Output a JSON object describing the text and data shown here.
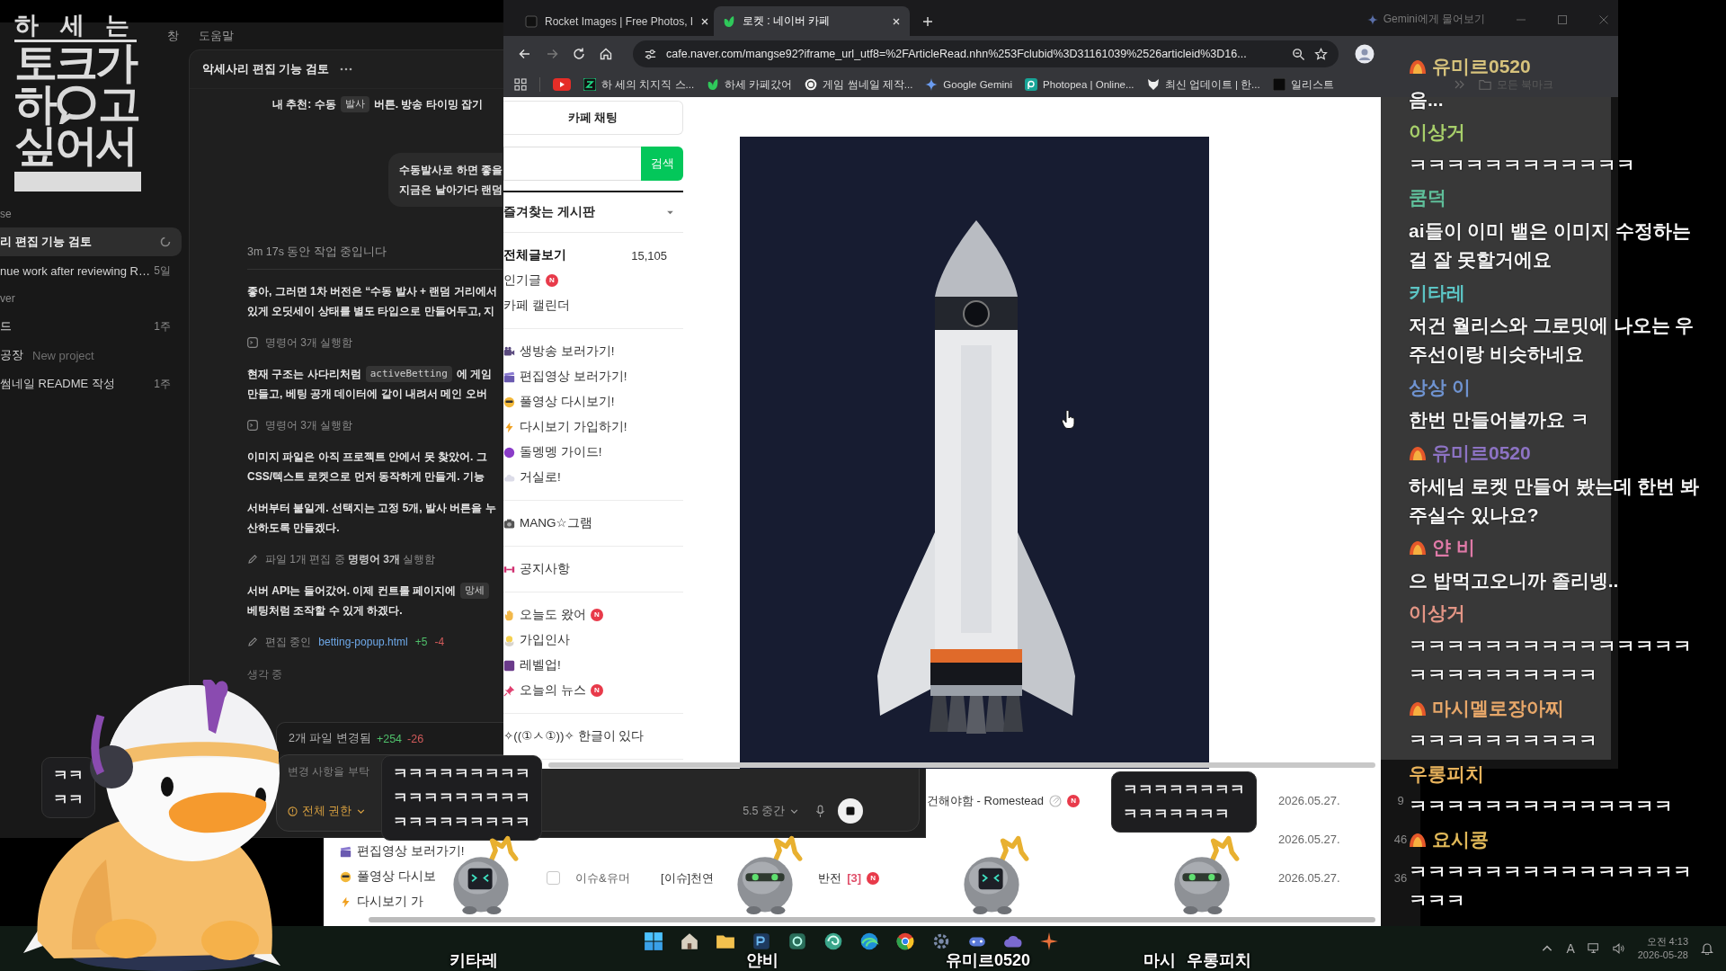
{
  "stream_logo": {
    "caption": "하 세 는",
    "line_1": "토크가",
    "line_2_start": "하",
    "line_2_end": "고",
    "line_3": "싶어서"
  },
  "code_app": {
    "menu": [
      "창",
      "도움말"
    ],
    "sidebar": [
      {
        "kind": "section",
        "label": "se"
      },
      {
        "kind": "thread",
        "label": "리 편집 기능 검토",
        "selected": true,
        "running": true
      },
      {
        "kind": "thread",
        "label": "nue work after reviewing R…",
        "selected": false,
        "running": false,
        "age": "5일"
      },
      {
        "kind": "section",
        "label": "ver"
      },
      {
        "kind": "thread",
        "label": "드",
        "selected": false,
        "running": false,
        "age": "1주"
      },
      {
        "kind": "thread",
        "label": "공장",
        "selected": false,
        "running": false,
        "tag": "New project"
      },
      {
        "kind": "thread",
        "label": "썸네일 README 작성",
        "selected": false,
        "running": false,
        "age": "1주"
      }
    ],
    "thread_title": "악세사리 편집 기능 검토",
    "messages": [
      {
        "kind": "list_item",
        "lines": [
          [
            {
              "text": "내 추천: 수동"
            },
            {
              "code": "발사"
            },
            {
              "text": "버튼. 방송 타이밍 잡기"
            }
          ]
        ]
      },
      {
        "kind": "user",
        "lines": [
          "수동발사로 하면 좋을",
          "지금은 날아가다 랜덤"
        ]
      },
      {
        "kind": "status",
        "text": "3m 17s 동안 작업 중입니다"
      },
      {
        "kind": "text",
        "lines": [
          "좋아, 그러면 1차 버전은 “수동 발사 + 랜덤 거리에서",
          "있게 오딧세이 상태를 별도 타입으로 만들어두고, 지"
        ]
      },
      {
        "kind": "tool",
        "text": "명령어 3개 실행함"
      },
      {
        "kind": "text",
        "lines": [
          [
            {
              "text": "현재 구조는 사다리처럼"
            },
            {
              "code": "activeBetting"
            },
            {
              "text": "에 게임"
            }
          ],
          "만들고, 베팅 공개 데이터에 같이 내려서 메인 오버"
        ]
      },
      {
        "kind": "tool",
        "text": "명령어 3개 실행함"
      },
      {
        "kind": "text",
        "lines": [
          "이미지 파일은 아직 프로젝트 안에서 못 찾았어. 그",
          "CSS/텍스트 로켓으로 먼저 동작하게 만들게. 기능"
        ]
      },
      {
        "kind": "text",
        "lines": [
          "서버부터 붙일게. 선택지는 고정 5개, 발사 버튼을 누",
          "산하도록 만들겠다."
        ]
      },
      {
        "kind": "edit",
        "text": "파일 1개 편집 중 **명령어 3개** 실행함"
      },
      {
        "kind": "text",
        "lines": [
          [
            {
              "text": "서버 API는 들어갔어. 이제 컨트롤 페이지에"
            },
            {
              "code": "망세"
            }
          ],
          "베팅처럼 조작할 수 있게 하겠다."
        ]
      },
      {
        "kind": "file_edit",
        "label": "편집 중인",
        "file": "betting-popup.html",
        "added": "+5",
        "removed": "-4"
      },
      {
        "kind": "thinking",
        "text": "생각 중"
      }
    ],
    "changes": {
      "label": "2개 파일 변경됨",
      "added": "+254",
      "removed": "-26"
    },
    "composer": {
      "placeholder": "변경 사항을 부탁",
      "permission": "전체 권한",
      "model": "5.5 중간"
    }
  },
  "browser": {
    "tabs": [
      {
        "title": "Rocket Images | Free Photos, I",
        "selected": false
      },
      {
        "title": "로켓 : 네이버 카페",
        "selected": true
      }
    ],
    "gemini": "Gemini에게 물어보기",
    "url": "cafe.naver.com/mangse92?iframe_url_utf8=%2FArticleRead.nhn%253Fclubid%3D31161039%2526articleid%3D16...",
    "bookmarks": [
      "하 세의 치지직 스...",
      "하세 카페갔어",
      "게임 썸네일 제작...",
      "Google Gemini",
      "Photopea | Online...",
      "최신 업데이트 | 한...",
      "일리스트"
    ],
    "all_bookmarks": "모든 북마크",
    "cafe": {
      "chat_button": "카페 채팅",
      "search_button": "검색",
      "favorites": "즐겨찾는 게시판",
      "groups": [
        [
          {
            "kind": "total",
            "label": "전체글보기",
            "count": "15,105"
          },
          {
            "kind": "board",
            "label": "인기글",
            "badge": "N"
          },
          {
            "kind": "board",
            "label": "카페 캘린더"
          }
        ],
        [
          {
            "kind": "emoji_board",
            "label": "생방송 보러가기!"
          },
          {
            "kind": "emoji_board",
            "label": "편집영상 보러가기!"
          },
          {
            "kind": "emoji_board",
            "label": "풀영상 다시보기!"
          },
          {
            "kind": "emoji_board",
            "label": "다시보기 가입하기!"
          },
          {
            "kind": "emoji_board",
            "label": "돌멩멩 가이드!"
          },
          {
            "kind": "emoji_board",
            "label": "거실로!"
          }
        ],
        [
          {
            "kind": "emoji_board",
            "label": "MANG☆그램"
          }
        ],
        [
          {
            "kind": "emoji_board",
            "label": "공지사항"
          }
        ],
        [
          {
            "kind": "emoji_board",
            "label": "오늘도 왔어",
            "badge": "N"
          },
          {
            "kind": "emoji_board",
            "label": "가입인사"
          },
          {
            "kind": "emoji_board",
            "label": "레벨업!"
          },
          {
            "kind": "emoji_board",
            "label": "오늘의 뉴스",
            "badge": "N"
          }
        ],
        [
          {
            "kind": "board",
            "label": "✧((①ㅅ①))✧ 한글이 있다"
          }
        ]
      ]
    }
  },
  "chat": [
    {
      "user": "유미르0520",
      "color": "#d6c27c",
      "badge": true,
      "text": "음..."
    },
    {
      "user": "이상거",
      "color": "#a7cf6a",
      "badge": false,
      "text": "ㅋㅋㅋㅋㅋㅋㅋㅋㅋㅋㅋㅋ"
    },
    {
      "user": "쿰덕",
      "color": "#5fbf9a",
      "badge": false,
      "text": "ai들이 이미 뱉은 이미지 수정하는 걸 잘 못할거에요"
    },
    {
      "user": "키타레",
      "color": "#5cc4c4",
      "badge": false,
      "text": "저건 월리스와 그로밋에 나오는 우주선이랑 비슷하네요"
    },
    {
      "user": "상상 이",
      "color": "#6f93d0",
      "badge": false,
      "text": "한번 만들어볼까요 ㅋ"
    },
    {
      "user": "유미르0520",
      "color": "#8d73c4",
      "badge": true,
      "text": "하세님 로켓 만들어 봤는데 한번 봐주실수 있나요?"
    },
    {
      "user": "얀 비",
      "color": "#e07aa8",
      "badge": true,
      "text": "으 밥먹고오니까 졸리넹.."
    },
    {
      "user": "이상거",
      "color": "#e39585",
      "badge": false,
      "text": "ㅋㅋㅋㅋㅋㅋㅋㅋㅋㅋㅋㅋㅋㅋㅋㅋㅋㅋㅋㅋㅋㅋㅋㅋㅋ"
    },
    {
      "user": "마시멜로장아찌",
      "color": "#e7a769",
      "badge": true,
      "text": "ㅋㅋㅋㅋㅋㅋㅋㅋㅋㅋ"
    },
    {
      "user": "우롱피치",
      "color": "#e8b35c",
      "badge": false,
      "text": "ㅋㅋㅋㅋㅋㅋㅋㅋㅋㅋㅋㅋㅋㅋ"
    },
    {
      "user": "요시콩",
      "color": "#e0b858",
      "badge": true,
      "text": "ㅋㅋㅋㅋㅋㅋㅋㅋㅋㅋㅋㅋㅋㅋㅋㅋㅋㅋ"
    }
  ],
  "cafe_list": {
    "sidebar": [
      "편집영상 보러가기!",
      "풀영상 다시보",
      "다시보기 가"
    ],
    "rows": [
      {
        "title": "건해야함 - Romestead",
        "badge": "N",
        "date": "2026.05.27.",
        "views": "9"
      },
      {
        "date": "2026.05.27.",
        "views": "46"
      },
      {
        "checked": false,
        "category": "이슈&유머",
        "title": "[이슈]천연",
        "title_end": "반전",
        "comments": "[3]",
        "badge": "N",
        "date": "2026.05.27.",
        "views": "36"
      }
    ]
  },
  "bubbles": [
    {
      "lines": [
        "ㅋㅋ",
        "ㅋㅋ"
      ]
    },
    {
      "lines": [
        "ㅋㅋㅋㅋㅋㅋㅋㅋㅋ",
        "ㅋㅋㅋㅋㅋㅋㅋㅋㅋ",
        "ㅋㅋㅋㅋㅋㅋㅋㅋㅋ"
      ]
    },
    {
      "lines": [
        "ㅋㅋㅋㅋㅋㅋㅋㅋ",
        "ㅋㅋㅋㅋㅋㅋㅋ"
      ]
    }
  ],
  "avatar_names": [
    "키타레",
    "얀비",
    "유미르0520",
    "마시",
    "우롱피치"
  ],
  "taskbar": {
    "ime": "A",
    "time": "오전 4:13",
    "date": "2026-05-28"
  }
}
